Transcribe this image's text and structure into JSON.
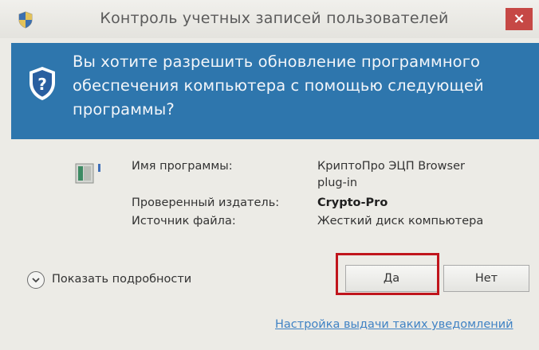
{
  "window": {
    "title": "Контроль учетных записей пользователей",
    "close_label": "×"
  },
  "banner": {
    "line1": "Вы хотите разрешить обновление программного",
    "line2": "обеспечения компьютера с помощью следующей",
    "line3": "программы?"
  },
  "info": {
    "program_name_label": "Имя программы:",
    "program_name_value_line1": "КриптоПро ЭЦП Browser",
    "program_name_value_line2": "plug-in",
    "publisher_label": "Проверенный издатель:",
    "publisher_value": "Crypto-Pro",
    "source_label": "Источник файла:",
    "source_value": "Жесткий диск компьютера"
  },
  "footer": {
    "details_label": "Показать подробности",
    "yes_label": "Да",
    "no_label": "Нет",
    "settings_link": "Настройка выдачи таких уведомлений"
  },
  "colors": {
    "banner": "#2e76ad",
    "close_button": "#c64845",
    "highlight_frame": "#c0151c",
    "link": "#3f82c4"
  },
  "icons": [
    "uac-shield-icon",
    "question-shield-icon",
    "program-icon",
    "chevron-down-icon"
  ]
}
